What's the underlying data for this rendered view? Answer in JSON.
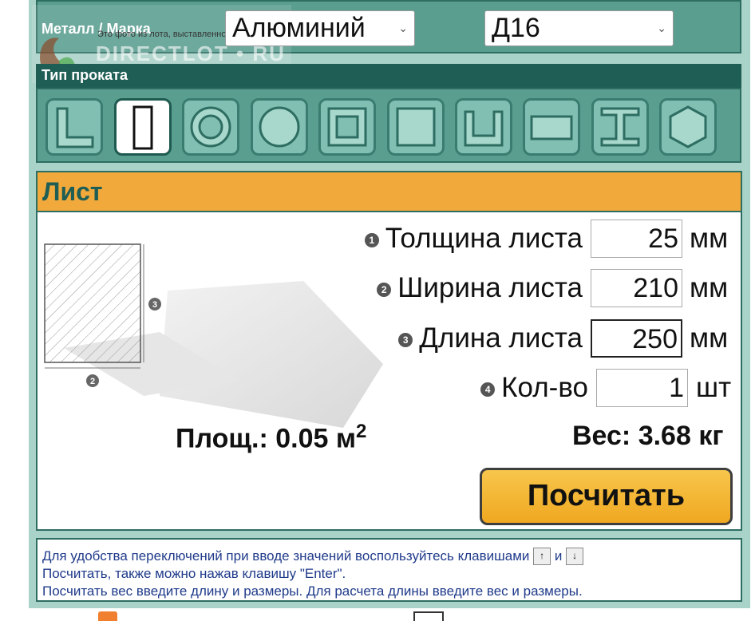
{
  "header": {
    "metal_label": "Металл / Марка",
    "metal_select": "Алюминий",
    "grade_select": "Д16",
    "type_label": "Тип проката",
    "watermark_note": "Это фото из лота, выставленного на",
    "watermark_text": "DIRECTLOT • RU"
  },
  "profile_types": [
    {
      "icon": "angle-profile-icon",
      "active": false
    },
    {
      "icon": "sheet-profile-icon",
      "active": true
    },
    {
      "icon": "pipe-profile-icon",
      "active": false
    },
    {
      "icon": "round-bar-profile-icon",
      "active": false
    },
    {
      "icon": "square-pipe-profile-icon",
      "active": false
    },
    {
      "icon": "square-bar-profile-icon",
      "active": false
    },
    {
      "icon": "channel-profile-icon",
      "active": false
    },
    {
      "icon": "strip-profile-icon",
      "active": false
    },
    {
      "icon": "i-beam-profile-icon",
      "active": false
    },
    {
      "icon": "hexagon-profile-icon",
      "active": false
    }
  ],
  "main": {
    "title": "Лист",
    "fields": [
      {
        "num": "1",
        "label": "Толщина листа",
        "value": "25",
        "unit": "мм"
      },
      {
        "num": "2",
        "label": "Ширина листа",
        "value": "210",
        "unit": "мм"
      },
      {
        "num": "3",
        "label": "Длина листа",
        "value": "250",
        "unit": "мм"
      },
      {
        "num": "4",
        "label": "Кол-во",
        "value": "1",
        "unit": "шт"
      }
    ],
    "diagram_labels": {
      "height_mark": "3",
      "width_mark": "2"
    },
    "area_text": "Площ.: 0.05 м",
    "area_sup": "2",
    "weight_text": "Вес: 3.68 кг",
    "calc_button": "Посчитать"
  },
  "info": {
    "line1": "Для удобства переключений при вводе значений воспользуйтесь клавишами",
    "line1_and": "и",
    "key_up": "↑",
    "key_down": "↓",
    "line2": "Посчитать, также можно нажав клавишу \"Enter\".",
    "line3": "Посчитать вес введите длину и размеры. Для расчета длины введите вес и размеры."
  },
  "colors": {
    "panel": "#5a9e90",
    "dark": "#1f5e54",
    "accent": "#f2a93c"
  }
}
